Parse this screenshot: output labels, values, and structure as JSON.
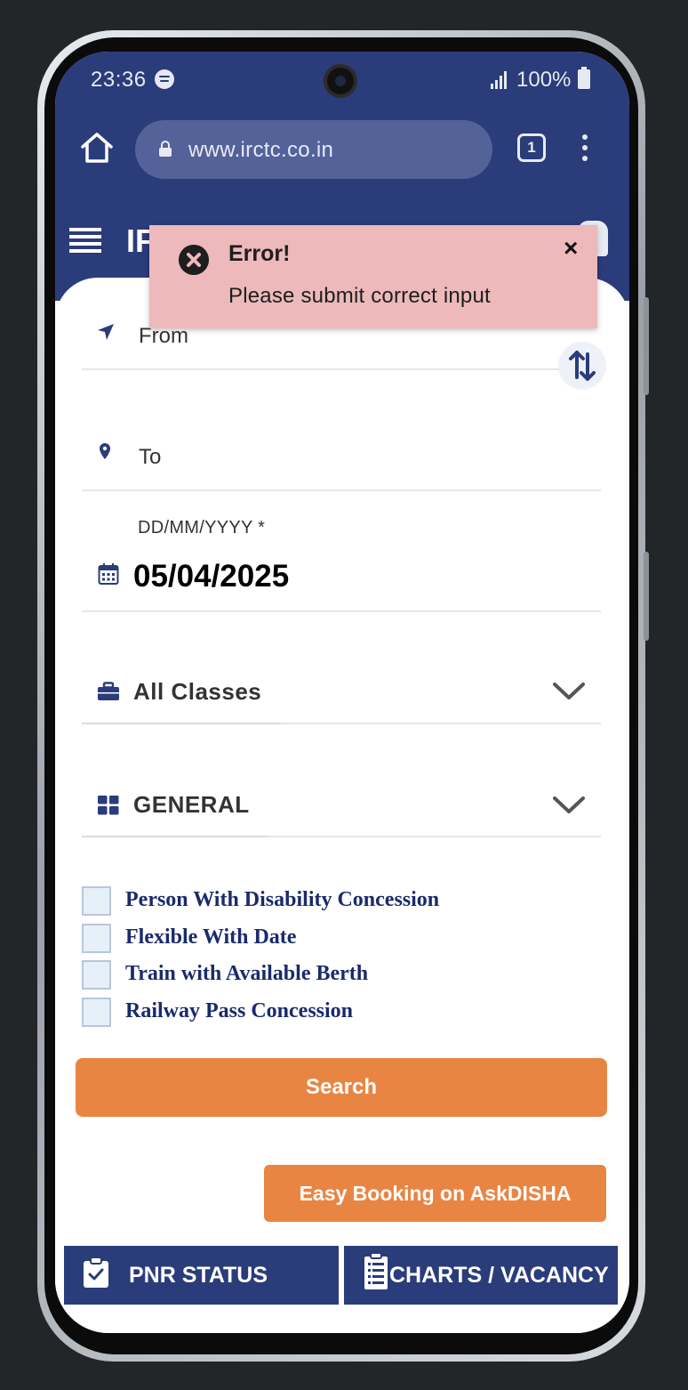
{
  "status_bar": {
    "time": "23:36",
    "battery": "100%",
    "icons": [
      "spotify-icon",
      "signal-icon",
      "battery-icon"
    ]
  },
  "browser": {
    "url": "www.irctc.co.in",
    "tab_count": "1",
    "icons": [
      "home-icon",
      "lock-icon",
      "tabs-icon",
      "more-vert-icon"
    ]
  },
  "app_header": {
    "brand_partial": "IF"
  },
  "form": {
    "from_label": "From",
    "to_label": "To",
    "date_label": "DD/MM/YYYY *",
    "date_value": "05/04/2025",
    "class_select": "All Classes",
    "quota_select": "GENERAL",
    "options": [
      {
        "label": "Person With Disability Concession",
        "checked": false
      },
      {
        "label": "Flexible With Date",
        "checked": false
      },
      {
        "label": "Train with Available Berth",
        "checked": false
      },
      {
        "label": "Railway Pass Concession",
        "checked": false
      }
    ],
    "search_label": "Search"
  },
  "disha_button": "Easy Booking on AskDISHA",
  "quick_links": [
    {
      "label": "PNR STATUS",
      "icon": "clipboard-check-icon"
    },
    {
      "label": "CHARTS / VACANCY",
      "icon": "list-doc-icon"
    }
  ],
  "toast": {
    "title": "Error!",
    "message": "Please submit correct input",
    "close": "×"
  },
  "colors": {
    "brand_navy": "#2a3c7a",
    "accent_orange": "#e98543",
    "error_bg": "#edb9bb"
  }
}
